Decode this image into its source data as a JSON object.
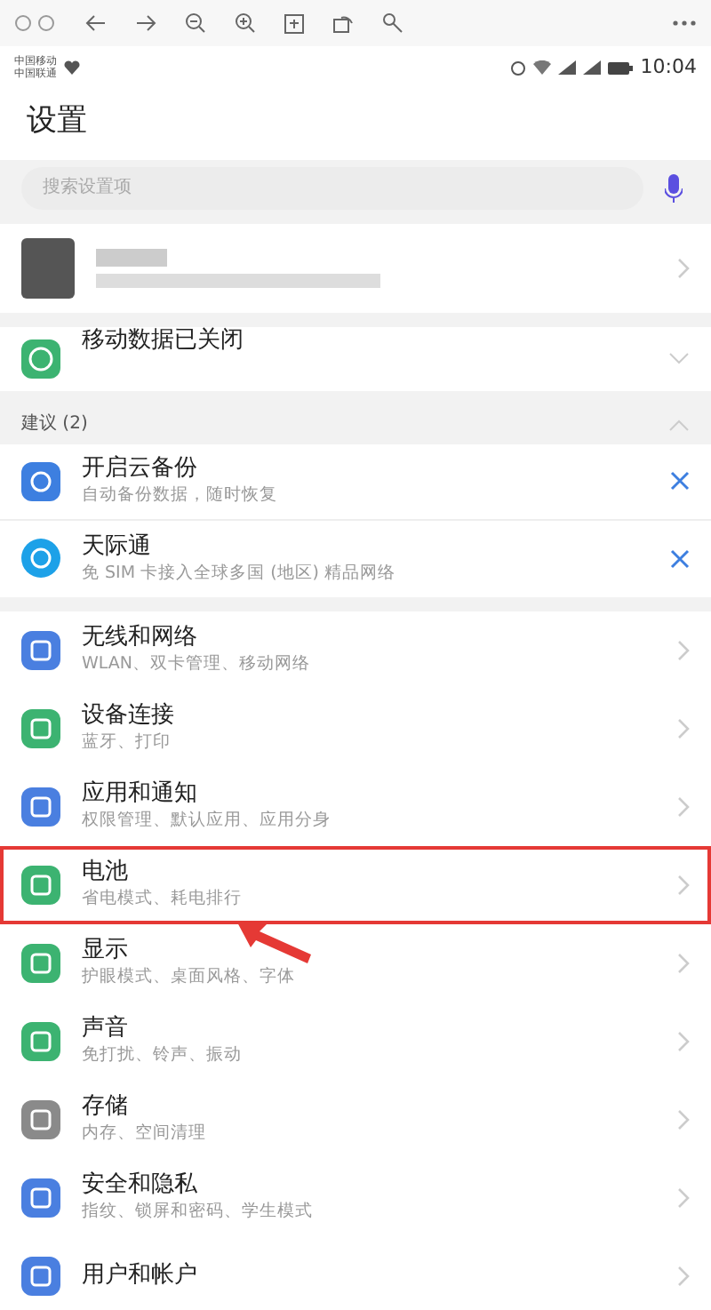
{
  "status_bar": {
    "carriers": [
      "中国移动",
      "中国联通"
    ],
    "time": "10:04"
  },
  "title": "设置",
  "search": {
    "placeholder": "搜索设置项"
  },
  "mobile_data": {
    "label": "移动数据已关闭",
    "expanded": false
  },
  "suggestions": {
    "header": "建议 (2)",
    "expanded": true,
    "items": [
      {
        "title": "开启云备份",
        "subtitle": "自动备份数据，随时恢复",
        "color": "#3d7fe0"
      },
      {
        "title": "天际通",
        "subtitle": "免 SIM 卡接入全球多国 (地区) 精品网络",
        "color": "#1da1e8"
      }
    ]
  },
  "settings": [
    {
      "title": "无线和网络",
      "subtitle": "WLAN、双卡管理、移动网络",
      "color": "#4a7fe0",
      "highlighted": false
    },
    {
      "title": "设备连接",
      "subtitle": "蓝牙、打印",
      "color": "#3cb371",
      "highlighted": false
    },
    {
      "title": "应用和通知",
      "subtitle": "权限管理、默认应用、应用分身",
      "color": "#4a7fe0",
      "highlighted": false
    },
    {
      "title": "电池",
      "subtitle": "省电模式、耗电排行",
      "color": "#3cb371",
      "highlighted": true
    },
    {
      "title": "显示",
      "subtitle": "护眼模式、桌面风格、字体",
      "color": "#3cb371",
      "highlighted": false
    },
    {
      "title": "声音",
      "subtitle": "免打扰、铃声、振动",
      "color": "#3cb371",
      "highlighted": false
    },
    {
      "title": "存储",
      "subtitle": "内存、空间清理",
      "color": "#8a8a8a",
      "highlighted": false
    },
    {
      "title": "安全和隐私",
      "subtitle": "指纹、锁屏和密码、学生模式",
      "color": "#4a7fe0",
      "highlighted": false
    },
    {
      "title": "用户和帐户",
      "color": "#4a7fe0",
      "highlighted": false
    }
  ]
}
